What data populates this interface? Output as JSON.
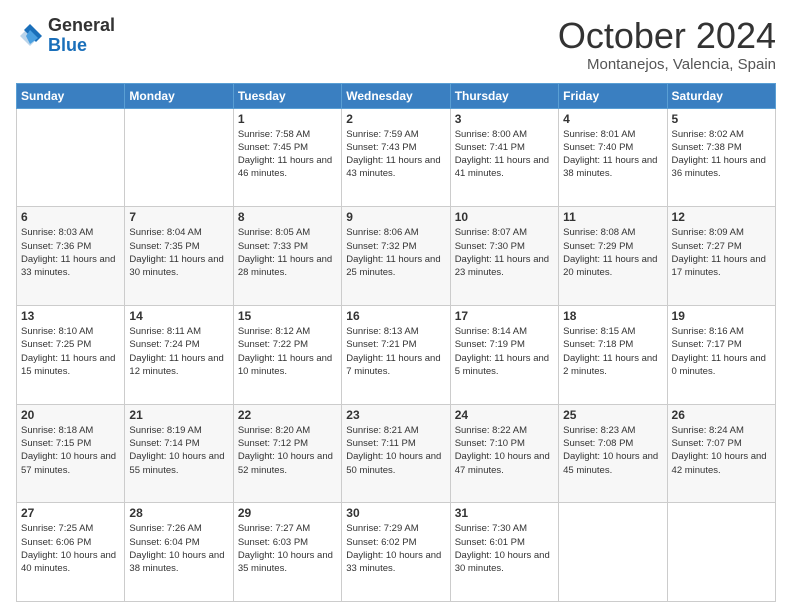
{
  "logo": {
    "general": "General",
    "blue": "Blue",
    "icon_color": "#1a6fba"
  },
  "header": {
    "month": "October 2024",
    "location": "Montanejos, Valencia, Spain"
  },
  "weekdays": [
    "Sunday",
    "Monday",
    "Tuesday",
    "Wednesday",
    "Thursday",
    "Friday",
    "Saturday"
  ],
  "weeks": [
    [
      {
        "day": "",
        "info": ""
      },
      {
        "day": "",
        "info": ""
      },
      {
        "day": "1",
        "info": "Sunrise: 7:58 AM\nSunset: 7:45 PM\nDaylight: 11 hours and 46 minutes."
      },
      {
        "day": "2",
        "info": "Sunrise: 7:59 AM\nSunset: 7:43 PM\nDaylight: 11 hours and 43 minutes."
      },
      {
        "day": "3",
        "info": "Sunrise: 8:00 AM\nSunset: 7:41 PM\nDaylight: 11 hours and 41 minutes."
      },
      {
        "day": "4",
        "info": "Sunrise: 8:01 AM\nSunset: 7:40 PM\nDaylight: 11 hours and 38 minutes."
      },
      {
        "day": "5",
        "info": "Sunrise: 8:02 AM\nSunset: 7:38 PM\nDaylight: 11 hours and 36 minutes."
      }
    ],
    [
      {
        "day": "6",
        "info": "Sunrise: 8:03 AM\nSunset: 7:36 PM\nDaylight: 11 hours and 33 minutes."
      },
      {
        "day": "7",
        "info": "Sunrise: 8:04 AM\nSunset: 7:35 PM\nDaylight: 11 hours and 30 minutes."
      },
      {
        "day": "8",
        "info": "Sunrise: 8:05 AM\nSunset: 7:33 PM\nDaylight: 11 hours and 28 minutes."
      },
      {
        "day": "9",
        "info": "Sunrise: 8:06 AM\nSunset: 7:32 PM\nDaylight: 11 hours and 25 minutes."
      },
      {
        "day": "10",
        "info": "Sunrise: 8:07 AM\nSunset: 7:30 PM\nDaylight: 11 hours and 23 minutes."
      },
      {
        "day": "11",
        "info": "Sunrise: 8:08 AM\nSunset: 7:29 PM\nDaylight: 11 hours and 20 minutes."
      },
      {
        "day": "12",
        "info": "Sunrise: 8:09 AM\nSunset: 7:27 PM\nDaylight: 11 hours and 17 minutes."
      }
    ],
    [
      {
        "day": "13",
        "info": "Sunrise: 8:10 AM\nSunset: 7:25 PM\nDaylight: 11 hours and 15 minutes."
      },
      {
        "day": "14",
        "info": "Sunrise: 8:11 AM\nSunset: 7:24 PM\nDaylight: 11 hours and 12 minutes."
      },
      {
        "day": "15",
        "info": "Sunrise: 8:12 AM\nSunset: 7:22 PM\nDaylight: 11 hours and 10 minutes."
      },
      {
        "day": "16",
        "info": "Sunrise: 8:13 AM\nSunset: 7:21 PM\nDaylight: 11 hours and 7 minutes."
      },
      {
        "day": "17",
        "info": "Sunrise: 8:14 AM\nSunset: 7:19 PM\nDaylight: 11 hours and 5 minutes."
      },
      {
        "day": "18",
        "info": "Sunrise: 8:15 AM\nSunset: 7:18 PM\nDaylight: 11 hours and 2 minutes."
      },
      {
        "day": "19",
        "info": "Sunrise: 8:16 AM\nSunset: 7:17 PM\nDaylight: 11 hours and 0 minutes."
      }
    ],
    [
      {
        "day": "20",
        "info": "Sunrise: 8:18 AM\nSunset: 7:15 PM\nDaylight: 10 hours and 57 minutes."
      },
      {
        "day": "21",
        "info": "Sunrise: 8:19 AM\nSunset: 7:14 PM\nDaylight: 10 hours and 55 minutes."
      },
      {
        "day": "22",
        "info": "Sunrise: 8:20 AM\nSunset: 7:12 PM\nDaylight: 10 hours and 52 minutes."
      },
      {
        "day": "23",
        "info": "Sunrise: 8:21 AM\nSunset: 7:11 PM\nDaylight: 10 hours and 50 minutes."
      },
      {
        "day": "24",
        "info": "Sunrise: 8:22 AM\nSunset: 7:10 PM\nDaylight: 10 hours and 47 minutes."
      },
      {
        "day": "25",
        "info": "Sunrise: 8:23 AM\nSunset: 7:08 PM\nDaylight: 10 hours and 45 minutes."
      },
      {
        "day": "26",
        "info": "Sunrise: 8:24 AM\nSunset: 7:07 PM\nDaylight: 10 hours and 42 minutes."
      }
    ],
    [
      {
        "day": "27",
        "info": "Sunrise: 7:25 AM\nSunset: 6:06 PM\nDaylight: 10 hours and 40 minutes."
      },
      {
        "day": "28",
        "info": "Sunrise: 7:26 AM\nSunset: 6:04 PM\nDaylight: 10 hours and 38 minutes."
      },
      {
        "day": "29",
        "info": "Sunrise: 7:27 AM\nSunset: 6:03 PM\nDaylight: 10 hours and 35 minutes."
      },
      {
        "day": "30",
        "info": "Sunrise: 7:29 AM\nSunset: 6:02 PM\nDaylight: 10 hours and 33 minutes."
      },
      {
        "day": "31",
        "info": "Sunrise: 7:30 AM\nSunset: 6:01 PM\nDaylight: 10 hours and 30 minutes."
      },
      {
        "day": "",
        "info": ""
      },
      {
        "day": "",
        "info": ""
      }
    ]
  ]
}
